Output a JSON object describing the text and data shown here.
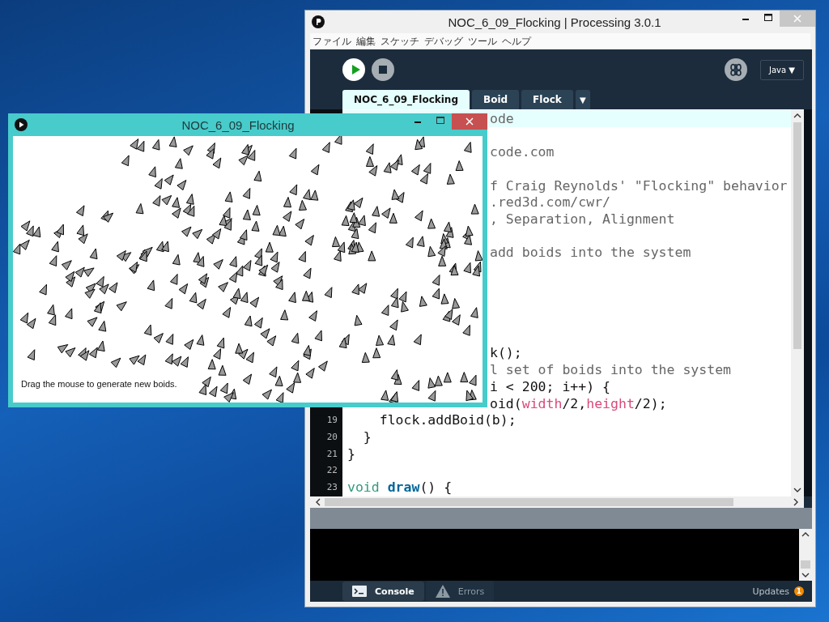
{
  "editor_window": {
    "title": "NOC_6_09_Flocking | Processing 3.0.1",
    "menu": [
      "ファイル",
      "編集",
      "スケッチ",
      "デバッグ",
      "ツール",
      "ヘルプ"
    ],
    "mode": {
      "label": "Java",
      "caret": "▼"
    },
    "tabs": [
      {
        "label": "NOC_6_09_Flocking",
        "selected": true
      },
      {
        "label": "Boid",
        "selected": false
      },
      {
        "label": "Flock",
        "selected": false
      }
    ],
    "tab_menu": "▼",
    "code_lines": [
      {
        "kind": "partial",
        "current": true,
        "segments": [
          {
            "text": "ode",
            "kind": "comment"
          }
        ]
      },
      {
        "kind": "blank",
        "current": false
      },
      {
        "kind": "partial",
        "current": false,
        "segments": [
          {
            "text": "code.com",
            "kind": "comment"
          }
        ]
      },
      {
        "kind": "blank",
        "current": false
      },
      {
        "kind": "partial",
        "current": false,
        "segments": [
          {
            "text": "f Craig Reynolds' \"Flocking\" behavior",
            "kind": "comment"
          }
        ]
      },
      {
        "kind": "partial",
        "current": false,
        "segments": [
          {
            "text": ".red3d.com/cwr/",
            "kind": "comment"
          }
        ]
      },
      {
        "kind": "partial",
        "current": false,
        "segments": [
          {
            "text": ", Separation, Alignment",
            "kind": "comment"
          }
        ]
      },
      {
        "kind": "blank",
        "current": false
      },
      {
        "kind": "partial",
        "current": false,
        "segments": [
          {
            "text": "add boids into the system",
            "kind": "comment"
          }
        ]
      },
      {
        "kind": "blank",
        "current": false
      },
      {
        "kind": "blank",
        "current": false
      },
      {
        "kind": "blank",
        "current": false
      },
      {
        "kind": "blank",
        "current": false
      },
      {
        "kind": "blank",
        "current": false
      },
      {
        "kind": "partial",
        "current": false,
        "segments": [
          {
            "text": "k();",
            "kind": "plain"
          }
        ]
      },
      {
        "kind": "partial",
        "current": false,
        "segments": [
          {
            "text": "l set of boids into the system",
            "kind": "comment"
          }
        ]
      },
      {
        "kind": "partial",
        "current": false,
        "segments": [
          {
            "text": "i < 200; i++) {",
            "kind": "plain"
          }
        ]
      },
      {
        "kind": "partial",
        "current": false,
        "segments": [
          {
            "text": "oid(",
            "kind": "plain"
          },
          {
            "text": "width",
            "kind": "builtin"
          },
          {
            "text": "/2,",
            "kind": "plain"
          },
          {
            "text": "height",
            "kind": "builtin"
          },
          {
            "text": "/2);",
            "kind": "plain"
          }
        ]
      },
      {
        "kind": "full",
        "number": "19",
        "current": false,
        "segments": [
          {
            "text": "    flock.addBoid(b);",
            "kind": "plain"
          }
        ]
      },
      {
        "kind": "full",
        "number": "20",
        "current": false,
        "segments": [
          {
            "text": "  }",
            "kind": "plain"
          }
        ]
      },
      {
        "kind": "full",
        "number": "21",
        "current": false,
        "segments": [
          {
            "text": "}",
            "kind": "plain"
          }
        ]
      },
      {
        "kind": "blank",
        "number": "22",
        "current": false
      },
      {
        "kind": "full",
        "number": "23",
        "current": false,
        "segments": [
          {
            "text": "void",
            "kind": "keyword"
          },
          {
            "text": "draw",
            "kind": "function"
          },
          {
            "text": "() {",
            "kind": "plain"
          }
        ]
      }
    ],
    "console_tabs": [
      {
        "label": "Console",
        "kind": "console",
        "selected": true
      },
      {
        "label": "Errors",
        "kind": "errors",
        "selected": false
      }
    ],
    "updates": {
      "label": "Updates",
      "count": "1"
    }
  },
  "sketch_window": {
    "title": "NOC_6_09_Flocking",
    "message": "Drag the mouse to generate new boids."
  }
}
